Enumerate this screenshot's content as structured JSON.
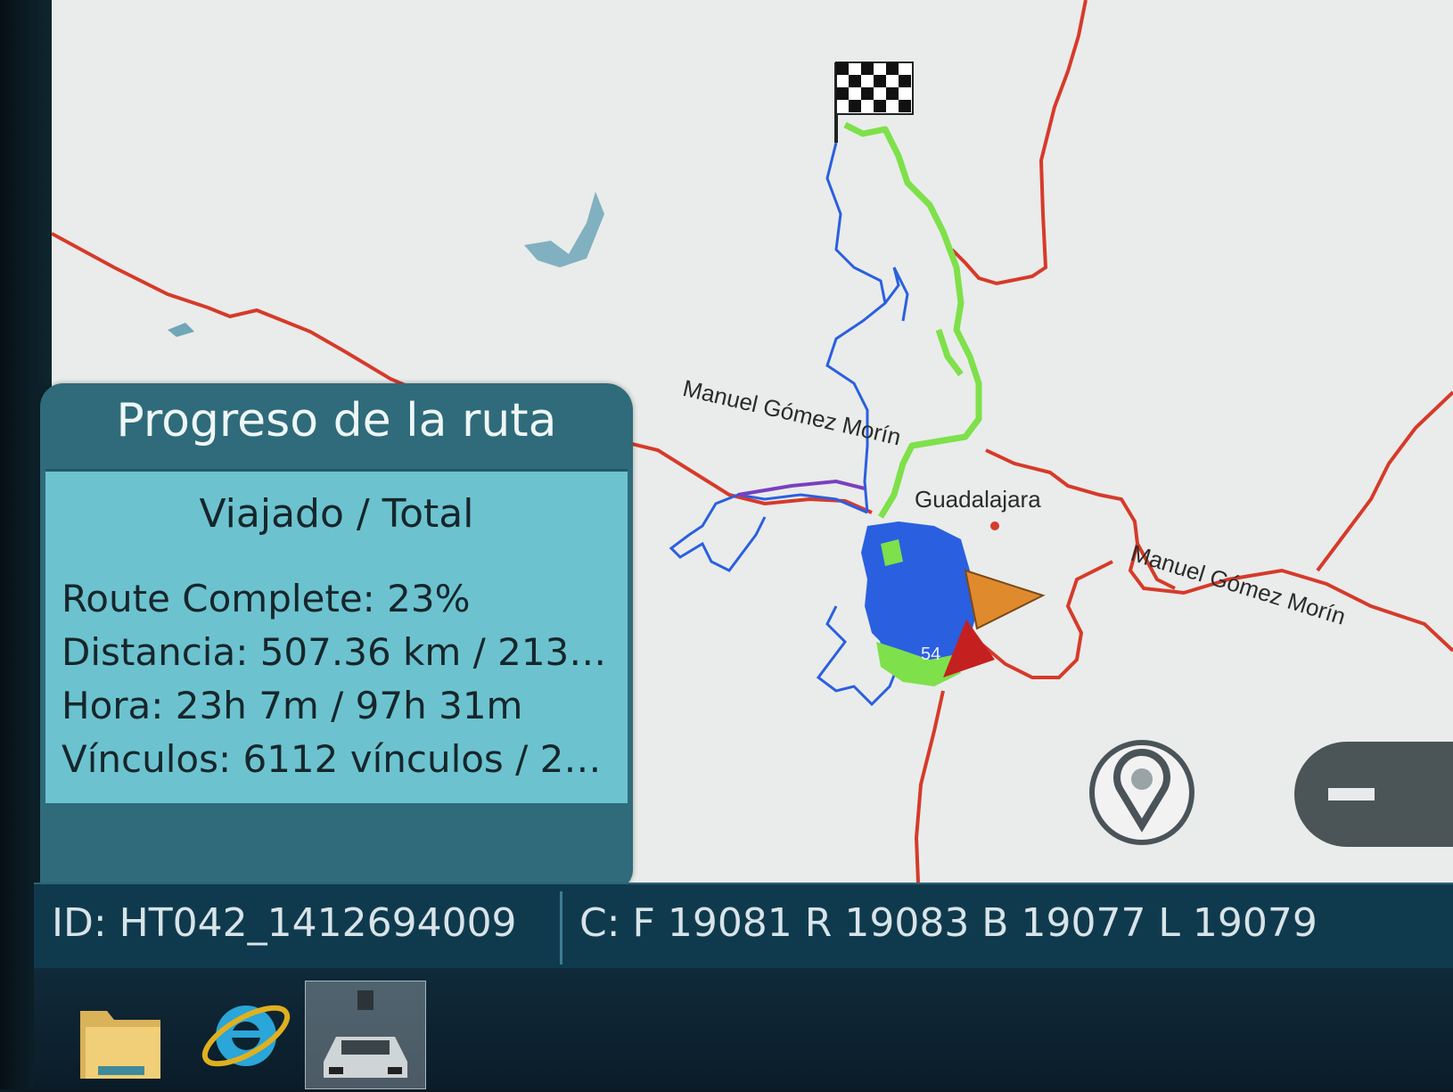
{
  "map": {
    "labels": {
      "road_upper": "Manuel Gómez Morín",
      "city": "Guadalajara",
      "road_right": "Manuel Gómez Morín"
    },
    "vehicle_marker_text": "54",
    "colors": {
      "background": "#e9ecea",
      "road": "#d63a2a",
      "traveled_route": "#7ee04a",
      "planned_route": "#2a5fe0",
      "water": "#6fa6b8"
    }
  },
  "progress_panel": {
    "title": "Progreso de la ruta",
    "subtitle": "Viajado / Total",
    "route_complete": "Route Complete: 23%",
    "route_complete_fraction": 0.23,
    "distancia": "Distancia: 507.36 km / 213…",
    "hora": "Hora: 23h 7m / 97h 31m",
    "vinculos": "Vínculos: 6112 vínculos / 2…"
  },
  "status_bar": {
    "id": "ID: HT042_1412694009",
    "counters": "C: F 19081 R 19083 B 19077 L 19079"
  },
  "controls": {
    "location_icon": "location-pin-icon",
    "zoom_out_icon": "minus-icon"
  },
  "taskbar": {
    "items": [
      {
        "icon": "folder-icon"
      },
      {
        "icon": "internet-explorer-icon"
      },
      {
        "icon": "car-camera-app-icon"
      }
    ]
  }
}
